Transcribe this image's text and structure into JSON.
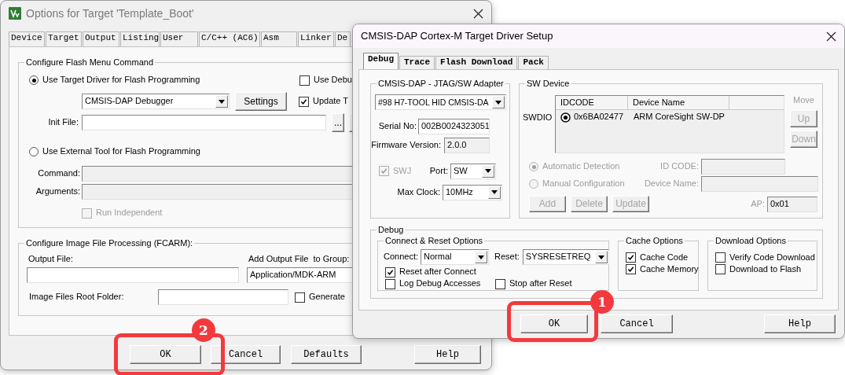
{
  "options_window": {
    "title": "Options for Target 'Template_Boot'",
    "tabs": [
      {
        "label": "Device",
        "selected": false
      },
      {
        "label": "Target",
        "selected": false
      },
      {
        "label": "Output",
        "selected": false
      },
      {
        "label": "Listing",
        "selected": false
      },
      {
        "label": "User",
        "selected": false
      },
      {
        "label": "C/C++ (AC6)",
        "selected": false
      },
      {
        "label": "Asm",
        "selected": false
      },
      {
        "label": "Linker",
        "selected": false
      },
      {
        "label": "De",
        "selected": false
      }
    ],
    "flash_group": {
      "title": "Configure Flash Menu Command",
      "use_target_driver": {
        "label": "Use Target Driver for Flash Programming",
        "selected": true
      },
      "use_debug": {
        "label": "Use Debu",
        "checked": false
      },
      "driver": {
        "value": "CMSIS-DAP Debugger"
      },
      "settings_button": {
        "label": "Settings"
      },
      "update_target": {
        "label": "Update T",
        "checked": true
      },
      "init_file": {
        "label": "Init File:"
      },
      "browse_button": {
        "label": "..."
      },
      "use_external_tool": {
        "label": "Use External Tool for Flash Programming",
        "selected": false
      },
      "command": {
        "label": "Command:"
      },
      "arguments": {
        "label": "Arguments:"
      },
      "run_independent": {
        "label": "Run Independent",
        "checked": false,
        "disabled": true
      }
    },
    "image_group": {
      "title": "Configure Image File Processing (FCARM):",
      "output_file": {
        "label": "Output File:"
      },
      "add_to_group": {
        "label": "Add Output File  to Group:",
        "value": "Application/MDK-ARM"
      },
      "root_folder": {
        "label": "Image Files Root Folder:"
      },
      "generate": {
        "label": "Generate",
        "checked": false
      }
    },
    "buttons": [
      {
        "label": "OK"
      },
      {
        "label": "Cancel"
      },
      {
        "label": "Defaults"
      },
      {
        "label": "Help"
      }
    ]
  },
  "driver_window": {
    "title": "CMSIS-DAP Cortex-M Target Driver Setup",
    "tabs": [
      {
        "label": "Debug",
        "selected": true
      },
      {
        "label": "Trace",
        "selected": false
      },
      {
        "label": "Flash Download",
        "selected": false
      },
      {
        "label": "Pack",
        "selected": false
      }
    ],
    "adapter": {
      "title": "CMSIS-DAP - JTAG/SW Adapter",
      "device": "#98 H7-TOOL HID CMSIS-DA",
      "serial_label": "Serial No:",
      "serial": "002B0024323051",
      "firmware_label": "Firmware Version:",
      "firmware": "2.0.0",
      "swj": {
        "label": "SWJ",
        "checked": true,
        "disabled": true
      },
      "port_label": "Port:",
      "port": "SW",
      "max_clock_label": "Max Clock:",
      "max_clock": "10MHz"
    },
    "sw_device": {
      "title": "SW Device",
      "row_label": "SWDIO",
      "columns": [
        "IDCODE",
        "Device Name"
      ],
      "rows": [
        {
          "idcode": "0x6BA02477",
          "device_name": "ARM CoreSight SW-DP",
          "selected": true
        }
      ],
      "move_label": "Move",
      "move_buttons": [
        {
          "label": "Up",
          "disabled": true
        },
        {
          "label": "Down",
          "disabled": true
        }
      ],
      "detection": [
        {
          "label": "Automatic Detection",
          "selected": true,
          "disabled": true
        },
        {
          "label": "Manual Configuration",
          "selected": false,
          "disabled": true
        }
      ],
      "id_code_label": "ID CODE:",
      "device_name_label": "Device Name:",
      "buttons": [
        {
          "label": "Add",
          "disabled": true
        },
        {
          "label": "Delete",
          "disabled": true
        },
        {
          "label": "Update",
          "disabled": true
        }
      ],
      "ap_label": "AP:",
      "ap": "0x01"
    },
    "debug": {
      "title": "Debug",
      "connect_reset": {
        "title": "Connect & Reset Options",
        "connect_label": "Connect:",
        "connect": "Normal",
        "reset_label": "Reset:",
        "reset": "SYSRESETREQ",
        "options": [
          {
            "label": "Reset after Connect",
            "checked": true
          },
          {
            "label": "Log Debug Accesses",
            "checked": false
          },
          {
            "label": "Stop after Reset",
            "checked": false
          }
        ]
      },
      "cache": {
        "title": "Cache Options",
        "options": [
          {
            "label": "Cache Code",
            "checked": true
          },
          {
            "label": "Cache Memory",
            "checked": true
          }
        ]
      },
      "download": {
        "title": "Download Options",
        "options": [
          {
            "label": "Verify Code Download",
            "checked": false
          },
          {
            "label": "Download to Flash",
            "checked": false
          }
        ]
      }
    },
    "buttons": [
      {
        "label": "OK"
      },
      {
        "label": "Cancel"
      },
      {
        "label": "Help"
      }
    ]
  },
  "annotations": [
    {
      "label": "1"
    },
    {
      "label": "2"
    }
  ]
}
